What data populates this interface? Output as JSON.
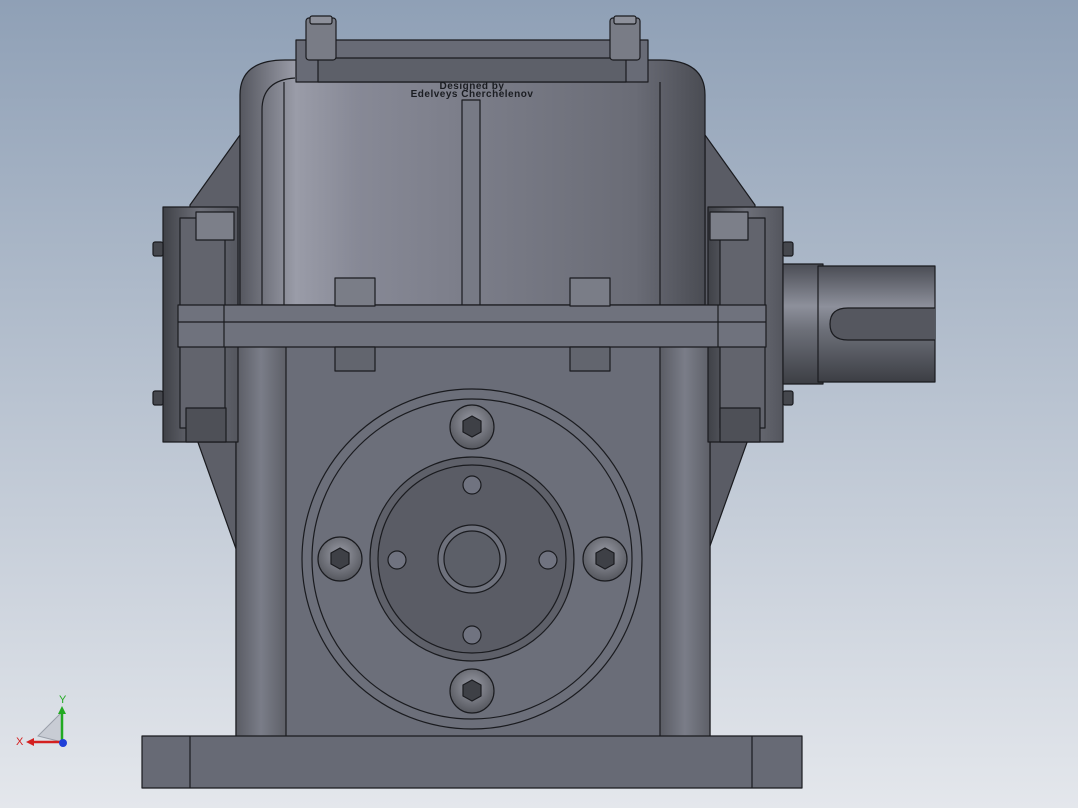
{
  "viewport": {
    "background_top": "#8fa0b6",
    "background_bottom": "#e4e7ec",
    "part_color": "#6c6f7a",
    "edge_color": "#1a1b1f"
  },
  "engraving": {
    "top_plate_text": "",
    "line1": "Designed by",
    "line2": "Edelveys Cherchelenov"
  },
  "triad": {
    "x_label": "X",
    "y_label": "Y",
    "x_color": "#d42020",
    "y_color": "#22aa22",
    "z_color": "#2040d8"
  }
}
